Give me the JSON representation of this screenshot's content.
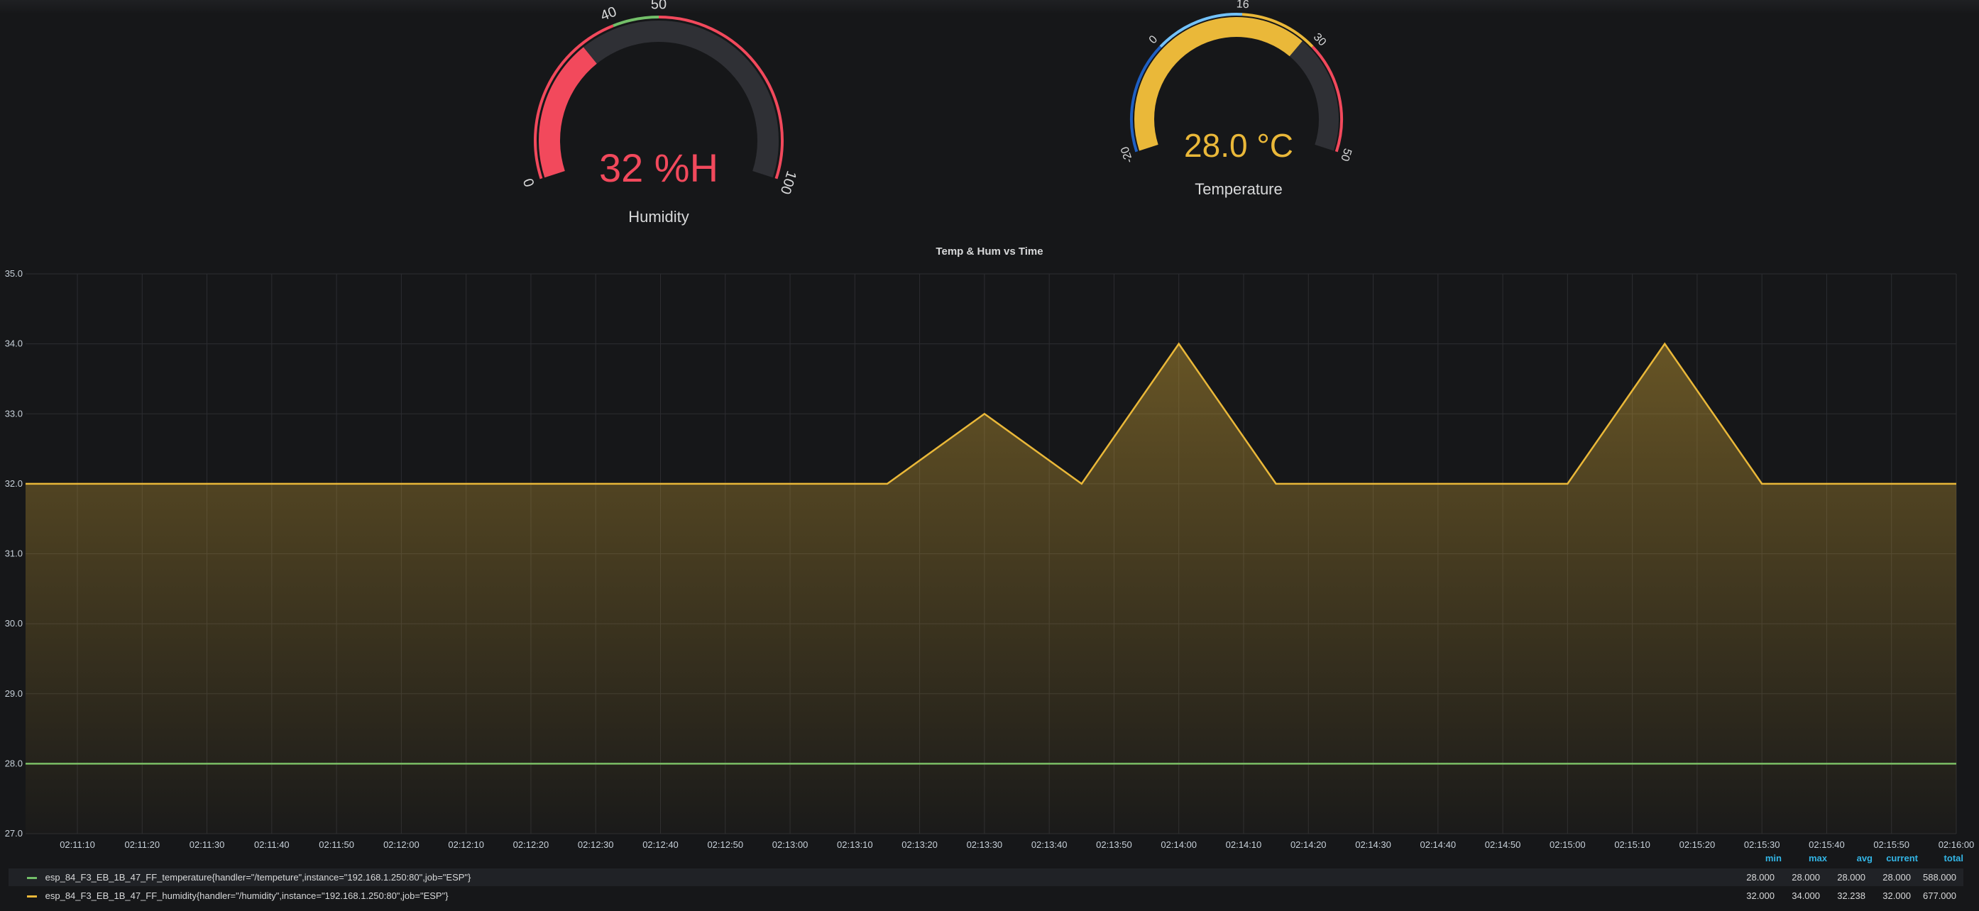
{
  "colors": {
    "background": "#161719",
    "red": "#f2495c",
    "green": "#73bf69",
    "blue": "#1f60c4",
    "light_blue": "#73c2fb",
    "yellow": "#eab839",
    "gauge_track": "#2f3035"
  },
  "humidity_gauge": {
    "value": 32,
    "value_text": "32 %H",
    "label": "Humidity",
    "min": 0,
    "max": 100,
    "ticks": [
      "0",
      "40",
      "50",
      "100"
    ],
    "thresholds": [
      {
        "from": 0,
        "to": 40,
        "color": "#f2495c"
      },
      {
        "from": 40,
        "to": 50,
        "color": "#73bf69"
      },
      {
        "from": 50,
        "to": 100,
        "color": "#f2495c"
      }
    ]
  },
  "temperature_gauge": {
    "value": 28.0,
    "value_text": "28.0 °C",
    "label": "Temperature",
    "min": -20,
    "max": 50,
    "ticks": [
      "-20",
      "0",
      "16",
      "30",
      "50"
    ],
    "thresholds": [
      {
        "from": -20,
        "to": 0,
        "color": "#1f60c4"
      },
      {
        "from": 0,
        "to": 16,
        "color": "#73c2fb"
      },
      {
        "from": 16,
        "to": 30,
        "color": "#eab839"
      },
      {
        "from": 30,
        "to": 50,
        "color": "#f2495c"
      }
    ]
  },
  "chart_data": {
    "type": "line",
    "title": "Temp & Hum vs Time",
    "xlabel": "",
    "ylabel": "",
    "ylim": [
      27.0,
      35.0
    ],
    "y_ticks": [
      "27.0",
      "28.0",
      "29.0",
      "30.0",
      "31.0",
      "32.0",
      "33.0",
      "34.0",
      "35.0"
    ],
    "x_ticks": [
      "02:11:10",
      "02:11:20",
      "02:11:30",
      "02:11:40",
      "02:11:50",
      "02:12:00",
      "02:12:10",
      "02:12:20",
      "02:12:30",
      "02:12:40",
      "02:12:50",
      "02:13:00",
      "02:13:10",
      "02:13:20",
      "02:13:30",
      "02:13:40",
      "02:13:50",
      "02:14:00",
      "02:14:10",
      "02:14:20",
      "02:14:30",
      "02:14:40",
      "02:14:50",
      "02:15:00",
      "02:15:10",
      "02:15:20",
      "02:15:30",
      "02:15:40",
      "02:15:50",
      "02:16:00"
    ],
    "xlim": [
      "02:11:02",
      "02:16:00"
    ],
    "grid": true,
    "legend_position": "bottom",
    "series": [
      {
        "name": "esp_84_F3_EB_1B_47_FF_temperature{handler=\"/tempeture\",instance=\"192.168.1.250:80\",job=\"ESP\"}",
        "color": "#73bf69",
        "fill": false,
        "points": [
          [
            "02:11:02",
            28.0
          ],
          [
            "02:16:00",
            28.0
          ]
        ],
        "stats": {
          "min": "28.000",
          "max": "28.000",
          "avg": "28.000",
          "current": "28.000",
          "total": "588.000"
        }
      },
      {
        "name": "esp_84_F3_EB_1B_47_FF_humidity{handler=\"/humidity\",instance=\"192.168.1.250:80\",job=\"ESP\"}",
        "color": "#eab839",
        "fill": true,
        "points": [
          [
            "02:11:02",
            32.0
          ],
          [
            "02:13:15",
            32.0
          ],
          [
            "02:13:30",
            33.0
          ],
          [
            "02:13:45",
            32.0
          ],
          [
            "02:14:00",
            34.0
          ],
          [
            "02:14:15",
            32.0
          ],
          [
            "02:15:00",
            32.0
          ],
          [
            "02:15:15",
            34.0
          ],
          [
            "02:15:30",
            32.0
          ],
          [
            "02:16:00",
            32.0
          ]
        ],
        "stats": {
          "min": "32.000",
          "max": "34.000",
          "avg": "32.238",
          "current": "32.000",
          "total": "677.000"
        }
      }
    ]
  },
  "legend": {
    "headers": [
      "min",
      "max",
      "avg",
      "current",
      "total"
    ]
  }
}
